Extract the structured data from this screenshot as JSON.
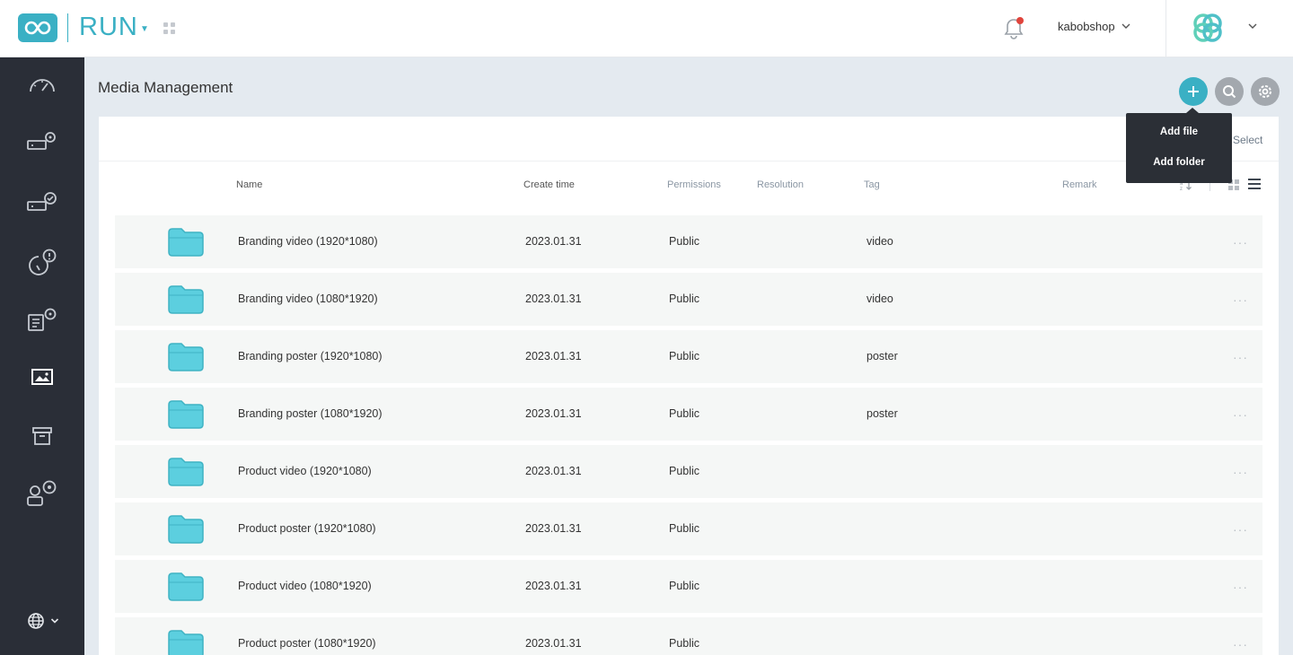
{
  "header": {
    "brand": "RUN",
    "username": "kabobshop"
  },
  "page": {
    "title": "Media Management",
    "select_label": "Select"
  },
  "add_menu": {
    "items": [
      "Add file",
      "Add folder"
    ]
  },
  "table": {
    "columns": {
      "name": "Name",
      "create_time": "Create time",
      "permissions": "Permissions",
      "resolution": "Resolution",
      "tag": "Tag",
      "remark": "Remark"
    },
    "rows": [
      {
        "name": "Branding video (1920*1080)",
        "create_time": "2023.01.31",
        "permissions": "Public",
        "tag": "video"
      },
      {
        "name": "Branding video (1080*1920)",
        "create_time": "2023.01.31",
        "permissions": "Public",
        "tag": "video"
      },
      {
        "name": "Branding poster (1920*1080)",
        "create_time": "2023.01.31",
        "permissions": "Public",
        "tag": "poster"
      },
      {
        "name": "Branding poster (1080*1920)",
        "create_time": "2023.01.31",
        "permissions": "Public",
        "tag": "poster"
      },
      {
        "name": "Product video (1920*1080)",
        "create_time": "2023.01.31",
        "permissions": "Public",
        "tag": ""
      },
      {
        "name": "Product poster (1920*1080)",
        "create_time": "2023.01.31",
        "permissions": "Public",
        "tag": ""
      },
      {
        "name": "Product video (1080*1920)",
        "create_time": "2023.01.31",
        "permissions": "Public",
        "tag": ""
      },
      {
        "name": "Product poster (1080*1920)",
        "create_time": "2023.01.31",
        "permissions": "Public",
        "tag": ""
      }
    ]
  },
  "sidebar": {
    "items": [
      "dashboard-icon",
      "device-settings-icon",
      "device-check-icon",
      "alert-icon",
      "content-settings-icon",
      "media-icon",
      "archive-icon",
      "user-settings-icon"
    ],
    "active": "media-icon"
  },
  "colors": {
    "accent": "#3ab0c4",
    "sidebar": "#2a2e37",
    "notification": "#e0443c"
  }
}
